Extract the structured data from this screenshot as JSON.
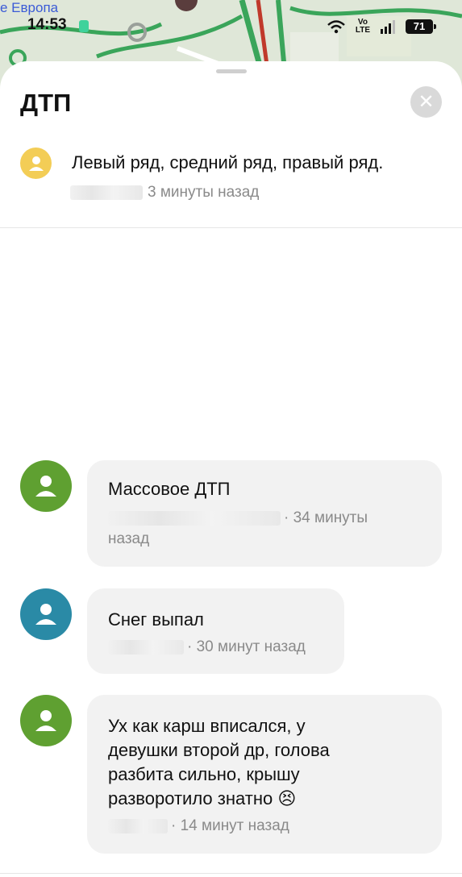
{
  "status_bar": {
    "map_label": "е Европа",
    "time": "14:53",
    "network": "LTE",
    "volte": "Vo",
    "battery": "71"
  },
  "sheet": {
    "title": "ДТП",
    "close_icon": "close-icon"
  },
  "top_comment": {
    "text": "Левый ряд, средний ряд, правый ряд.",
    "time": "3 минуты назад",
    "avatar_color": "#f3cd56"
  },
  "comments": [
    {
      "text": "Массовое ДТП",
      "time_line1": "· 34 минуты",
      "time_line2": "назад",
      "avatar_color": "#5fa031"
    },
    {
      "text": "Снег выпал",
      "time": "· 30 минут назад",
      "avatar_color": "#2a8aa6"
    },
    {
      "text_lines": [
        "Ух как карш вписался, у",
        "девушки второй др, голова",
        "разбита сильно, крышу",
        "разворотило знатно 😣"
      ],
      "time": "· 14 минут назад",
      "avatar_color": "#5fa031"
    }
  ]
}
